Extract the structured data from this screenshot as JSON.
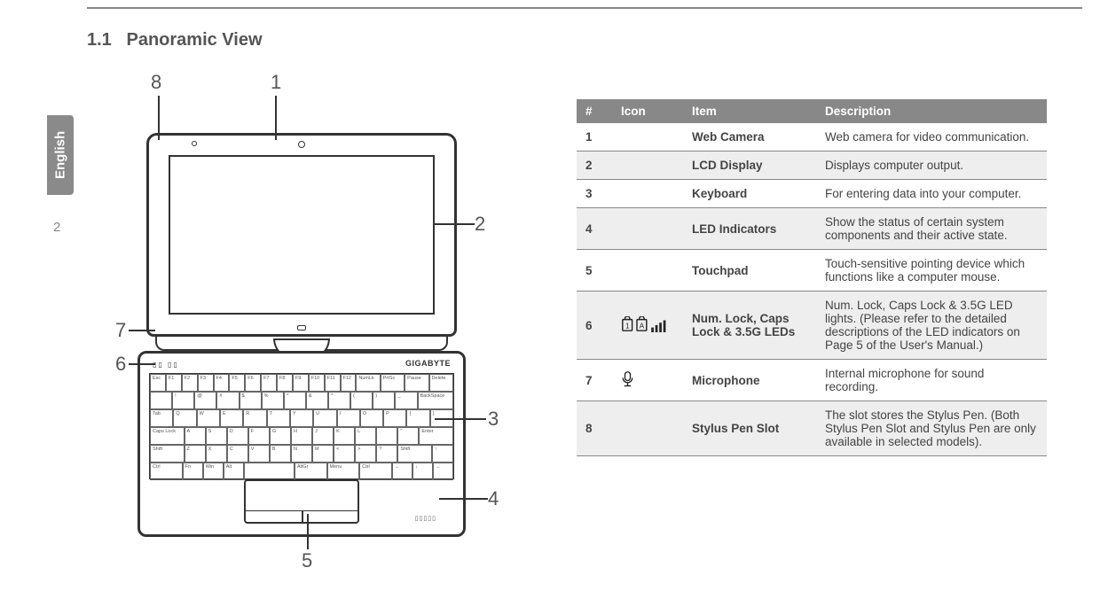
{
  "header_line": true,
  "section": {
    "number": "1.1",
    "title": "Panoramic View"
  },
  "side_tab": "English",
  "page_number": "2",
  "diagram": {
    "brand": "GIGABYTE",
    "callouts": [
      "1",
      "2",
      "3",
      "4",
      "5",
      "6",
      "7",
      "8"
    ],
    "keyboard_rows": [
      [
        "Esc",
        "F1",
        "F2",
        "F3",
        "F4",
        "F5",
        "F6",
        "F7",
        "F8",
        "F9",
        "F10",
        "F11",
        "F12",
        "NumLk",
        "PrtSc",
        "Pause",
        "Delete"
      ],
      [
        "`",
        "!",
        "@",
        "#",
        "$",
        "%",
        "^",
        "&",
        "*",
        "(",
        ")",
        "_",
        "BackSpace"
      ],
      [
        "Tab",
        "Q",
        "W",
        "E",
        "R",
        "T",
        "Y",
        "U",
        "I",
        "O",
        "P",
        "{",
        "}"
      ],
      [
        "Caps Lock",
        "A",
        "S",
        "D",
        "F",
        "G",
        "H",
        "J",
        "K",
        "L",
        ":",
        "\"",
        "Enter"
      ],
      [
        "Shift",
        "Z",
        "X",
        "C",
        "V",
        "B",
        "N",
        "M",
        "<",
        ">",
        "?",
        "Shift",
        "↑"
      ],
      [
        "Ctrl",
        "Fn",
        "Win",
        "Alt",
        "",
        "AltGr",
        "Menu",
        "Ctrl",
        "←",
        "↓",
        "→"
      ]
    ]
  },
  "table": {
    "headers": [
      "#",
      "Icon",
      "Item",
      "Description"
    ],
    "rows": [
      {
        "num": "1",
        "icon": "",
        "item": "Web Camera",
        "desc": "Web camera for video communication."
      },
      {
        "num": "2",
        "icon": "",
        "item": "LCD Display",
        "desc": "Displays computer output."
      },
      {
        "num": "3",
        "icon": "",
        "item": "Keyboard",
        "desc": "For entering data into your computer."
      },
      {
        "num": "4",
        "icon": "",
        "item": "LED Indicators",
        "desc": "Show the status of certain system components and their active state."
      },
      {
        "num": "5",
        "icon": "",
        "item": "Touchpad",
        "desc": "Touch-sensitive pointing device which functions like a computer mouse."
      },
      {
        "num": "6",
        "icon": "lock-leds",
        "item": "Num. Lock, Caps Lock & 3.5G LEDs",
        "desc": "Num. Lock, Caps Lock & 3.5G LED lights. (Please refer to the detailed descriptions of the LED indicators on Page 5 of the User's Manual.)"
      },
      {
        "num": "7",
        "icon": "mic",
        "item": "Microphone",
        "desc": "Internal microphone for sound recording."
      },
      {
        "num": "8",
        "icon": "",
        "item": "Stylus Pen Slot",
        "desc": "The slot stores the Stylus Pen. (Both Stylus Pen Slot and Stylus Pen are only available in selected models)."
      }
    ]
  }
}
